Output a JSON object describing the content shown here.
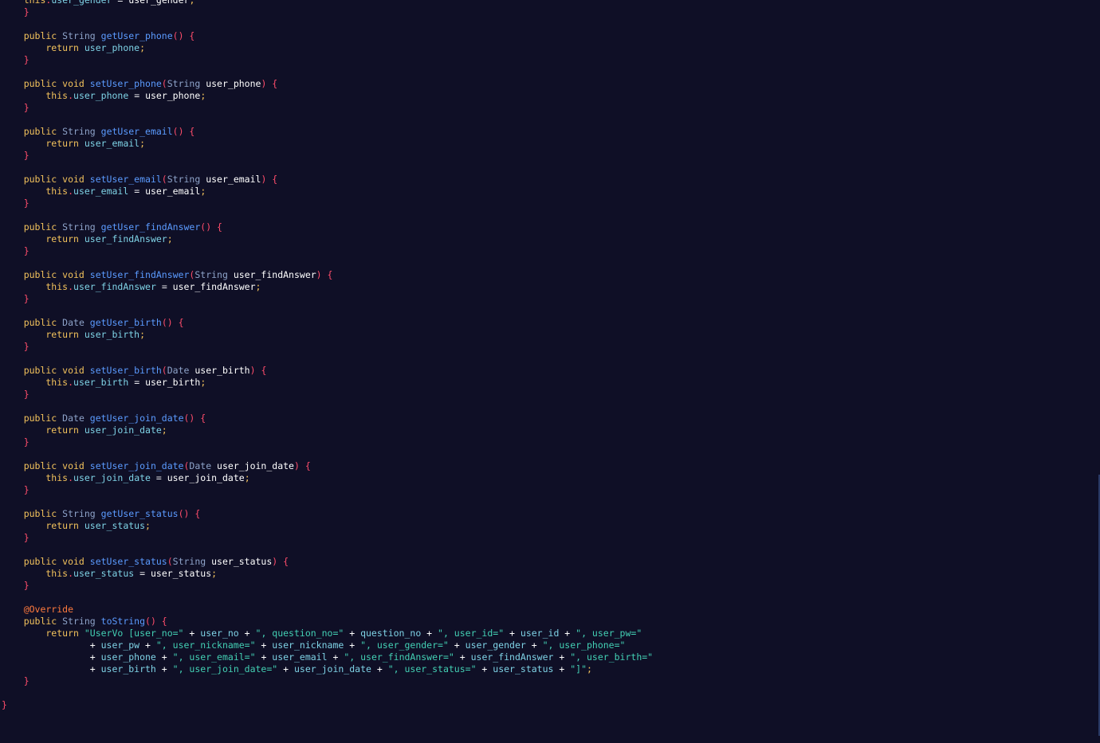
{
  "editor": {
    "language": "Java",
    "theme": {
      "background": "#0f0f26",
      "keyword": "#f2c25c",
      "type": "#8ea3c9",
      "function": "#5b9bff",
      "field": "#7fd3e6",
      "variable": "#ffffff",
      "punctuation": "#ff4d6b",
      "string": "#43d0b4",
      "annotation": "#ff7a3d"
    },
    "lines": [
      [
        [
          "kw",
          "    this"
        ],
        [
          "punc",
          "."
        ],
        [
          "field",
          "user_gender"
        ],
        [
          "plain",
          " = "
        ],
        [
          "var",
          "user_gender"
        ],
        [
          "semi",
          ";"
        ]
      ],
      [
        [
          "punc",
          "    }"
        ]
      ],
      [],
      [
        [
          "kw",
          "    public "
        ],
        [
          "type",
          "String "
        ],
        [
          "fn",
          "getUser_phone"
        ],
        [
          "punc",
          "() {"
        ]
      ],
      [
        [
          "kw",
          "        return "
        ],
        [
          "field",
          "user_phone"
        ],
        [
          "semi",
          ";"
        ]
      ],
      [
        [
          "punc",
          "    }"
        ]
      ],
      [],
      [
        [
          "kw",
          "    public void "
        ],
        [
          "fn",
          "setUser_phone"
        ],
        [
          "punc",
          "("
        ],
        [
          "type",
          "String "
        ],
        [
          "var",
          "user_phone"
        ],
        [
          "punc",
          ") {"
        ]
      ],
      [
        [
          "kw",
          "        this"
        ],
        [
          "punc",
          "."
        ],
        [
          "field",
          "user_phone"
        ],
        [
          "plain",
          " = "
        ],
        [
          "var",
          "user_phone"
        ],
        [
          "semi",
          ";"
        ]
      ],
      [
        [
          "punc",
          "    }"
        ]
      ],
      [],
      [
        [
          "kw",
          "    public "
        ],
        [
          "type",
          "String "
        ],
        [
          "fn",
          "getUser_email"
        ],
        [
          "punc",
          "() {"
        ]
      ],
      [
        [
          "kw",
          "        return "
        ],
        [
          "field",
          "user_email"
        ],
        [
          "semi",
          ";"
        ]
      ],
      [
        [
          "punc",
          "    }"
        ]
      ],
      [],
      [
        [
          "kw",
          "    public void "
        ],
        [
          "fn",
          "setUser_email"
        ],
        [
          "punc",
          "("
        ],
        [
          "type",
          "String "
        ],
        [
          "var",
          "user_email"
        ],
        [
          "punc",
          ") {"
        ]
      ],
      [
        [
          "kw",
          "        this"
        ],
        [
          "punc",
          "."
        ],
        [
          "field",
          "user_email"
        ],
        [
          "plain",
          " = "
        ],
        [
          "var",
          "user_email"
        ],
        [
          "semi",
          ";"
        ]
      ],
      [
        [
          "punc",
          "    }"
        ]
      ],
      [],
      [
        [
          "kw",
          "    public "
        ],
        [
          "type",
          "String "
        ],
        [
          "fn",
          "getUser_findAnswer"
        ],
        [
          "punc",
          "() {"
        ]
      ],
      [
        [
          "kw",
          "        return "
        ],
        [
          "field",
          "user_findAnswer"
        ],
        [
          "semi",
          ";"
        ]
      ],
      [
        [
          "punc",
          "    }"
        ]
      ],
      [],
      [
        [
          "kw",
          "    public void "
        ],
        [
          "fn",
          "setUser_findAnswer"
        ],
        [
          "punc",
          "("
        ],
        [
          "type",
          "String "
        ],
        [
          "var",
          "user_findAnswer"
        ],
        [
          "punc",
          ") {"
        ]
      ],
      [
        [
          "kw",
          "        this"
        ],
        [
          "punc",
          "."
        ],
        [
          "field",
          "user_findAnswer"
        ],
        [
          "plain",
          " = "
        ],
        [
          "var",
          "user_findAnswer"
        ],
        [
          "semi",
          ";"
        ]
      ],
      [
        [
          "punc",
          "    }"
        ]
      ],
      [],
      [
        [
          "kw",
          "    public "
        ],
        [
          "type",
          "Date "
        ],
        [
          "fn",
          "getUser_birth"
        ],
        [
          "punc",
          "() {"
        ]
      ],
      [
        [
          "kw",
          "        return "
        ],
        [
          "field",
          "user_birth"
        ],
        [
          "semi",
          ";"
        ]
      ],
      [
        [
          "punc",
          "    }"
        ]
      ],
      [],
      [
        [
          "kw",
          "    public void "
        ],
        [
          "fn",
          "setUser_birth"
        ],
        [
          "punc",
          "("
        ],
        [
          "type",
          "Date "
        ],
        [
          "var",
          "user_birth"
        ],
        [
          "punc",
          ") {"
        ]
      ],
      [
        [
          "kw",
          "        this"
        ],
        [
          "punc",
          "."
        ],
        [
          "field",
          "user_birth"
        ],
        [
          "plain",
          " = "
        ],
        [
          "var",
          "user_birth"
        ],
        [
          "semi",
          ";"
        ]
      ],
      [
        [
          "punc",
          "    }"
        ]
      ],
      [],
      [
        [
          "kw",
          "    public "
        ],
        [
          "type",
          "Date "
        ],
        [
          "fn",
          "getUser_join_date"
        ],
        [
          "punc",
          "() {"
        ]
      ],
      [
        [
          "kw",
          "        return "
        ],
        [
          "field",
          "user_join_date"
        ],
        [
          "semi",
          ";"
        ]
      ],
      [
        [
          "punc",
          "    }"
        ]
      ],
      [],
      [
        [
          "kw",
          "    public void "
        ],
        [
          "fn",
          "setUser_join_date"
        ],
        [
          "punc",
          "("
        ],
        [
          "type",
          "Date "
        ],
        [
          "var",
          "user_join_date"
        ],
        [
          "punc",
          ") {"
        ]
      ],
      [
        [
          "kw",
          "        this"
        ],
        [
          "punc",
          "."
        ],
        [
          "field",
          "user_join_date"
        ],
        [
          "plain",
          " = "
        ],
        [
          "var",
          "user_join_date"
        ],
        [
          "semi",
          ";"
        ]
      ],
      [
        [
          "punc",
          "    }"
        ]
      ],
      [],
      [
        [
          "kw",
          "    public "
        ],
        [
          "type",
          "String "
        ],
        [
          "fn",
          "getUser_status"
        ],
        [
          "punc",
          "() {"
        ]
      ],
      [
        [
          "kw",
          "        return "
        ],
        [
          "field",
          "user_status"
        ],
        [
          "semi",
          ";"
        ]
      ],
      [
        [
          "punc",
          "    }"
        ]
      ],
      [],
      [
        [
          "kw",
          "    public void "
        ],
        [
          "fn",
          "setUser_status"
        ],
        [
          "punc",
          "("
        ],
        [
          "type",
          "String "
        ],
        [
          "var",
          "user_status"
        ],
        [
          "punc",
          ") {"
        ]
      ],
      [
        [
          "kw",
          "        this"
        ],
        [
          "punc",
          "."
        ],
        [
          "field",
          "user_status"
        ],
        [
          "plain",
          " = "
        ],
        [
          "var",
          "user_status"
        ],
        [
          "semi",
          ";"
        ]
      ],
      [
        [
          "punc",
          "    }"
        ]
      ],
      [],
      [
        [
          "ann",
          "    @Override"
        ]
      ],
      [
        [
          "kw",
          "    public "
        ],
        [
          "type",
          "String "
        ],
        [
          "fn",
          "toString"
        ],
        [
          "punc",
          "() {"
        ]
      ],
      [
        [
          "kw",
          "        return "
        ],
        [
          "str",
          "\"UserVo [user_no=\""
        ],
        [
          "op",
          " + "
        ],
        [
          "field",
          "user_no"
        ],
        [
          "op",
          " + "
        ],
        [
          "str",
          "\", question_no=\""
        ],
        [
          "op",
          " + "
        ],
        [
          "field",
          "question_no"
        ],
        [
          "op",
          " + "
        ],
        [
          "str",
          "\", user_id=\""
        ],
        [
          "op",
          " + "
        ],
        [
          "field",
          "user_id"
        ],
        [
          "op",
          " + "
        ],
        [
          "str",
          "\", user_pw=\""
        ]
      ],
      [
        [
          "op",
          "                + "
        ],
        [
          "field",
          "user_pw"
        ],
        [
          "op",
          " + "
        ],
        [
          "str",
          "\", user_nickname=\""
        ],
        [
          "op",
          " + "
        ],
        [
          "field",
          "user_nickname"
        ],
        [
          "op",
          " + "
        ],
        [
          "str",
          "\", user_gender=\""
        ],
        [
          "op",
          " + "
        ],
        [
          "field",
          "user_gender"
        ],
        [
          "op",
          " + "
        ],
        [
          "str",
          "\", user_phone=\""
        ]
      ],
      [
        [
          "op",
          "                + "
        ],
        [
          "field",
          "user_phone"
        ],
        [
          "op",
          " + "
        ],
        [
          "str",
          "\", user_email=\""
        ],
        [
          "op",
          " + "
        ],
        [
          "field",
          "user_email"
        ],
        [
          "op",
          " + "
        ],
        [
          "str",
          "\", user_findAnswer=\""
        ],
        [
          "op",
          " + "
        ],
        [
          "field",
          "user_findAnswer"
        ],
        [
          "op",
          " + "
        ],
        [
          "str",
          "\", user_birth=\""
        ]
      ],
      [
        [
          "op",
          "                + "
        ],
        [
          "field",
          "user_birth"
        ],
        [
          "op",
          " + "
        ],
        [
          "str",
          "\", user_join_date=\""
        ],
        [
          "op",
          " + "
        ],
        [
          "field",
          "user_join_date"
        ],
        [
          "op",
          " + "
        ],
        [
          "str",
          "\", user_status=\""
        ],
        [
          "op",
          " + "
        ],
        [
          "field",
          "user_status"
        ],
        [
          "op",
          " + "
        ],
        [
          "str",
          "\"]\""
        ],
        [
          "semi",
          ";"
        ]
      ],
      [
        [
          "punc",
          "    }"
        ]
      ],
      [],
      [
        [
          "punc",
          "}"
        ]
      ]
    ]
  }
}
